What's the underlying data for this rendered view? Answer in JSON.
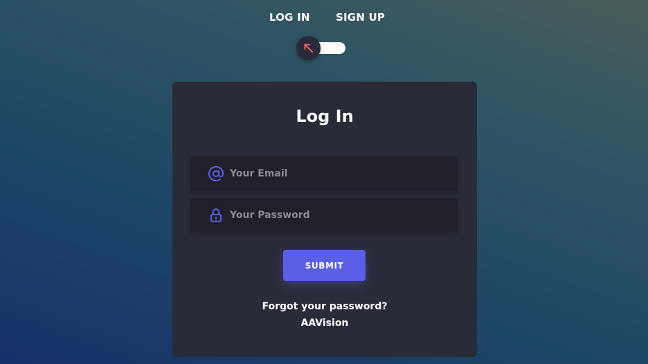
{
  "nav": {
    "tabs": [
      {
        "label": "LOG IN"
      },
      {
        "label": "SIGN UP"
      }
    ],
    "toggle_icon": "arrow-up-left-icon"
  },
  "card": {
    "title": "Log In",
    "email_field": {
      "placeholder": "Your Email",
      "value": "",
      "icon": "at-sign-icon"
    },
    "password_field": {
      "placeholder": "Your Password",
      "value": "",
      "icon": "lock-icon"
    },
    "submit_label": "SUBMIT",
    "forgot_link": "Forgot your password?",
    "brand": "AAVision"
  },
  "colors": {
    "accent": "#5b5fe6",
    "card_bg": "#2a2b38",
    "field_bg": "#1f2029",
    "toggle_arrow": "#ff6b6b"
  }
}
